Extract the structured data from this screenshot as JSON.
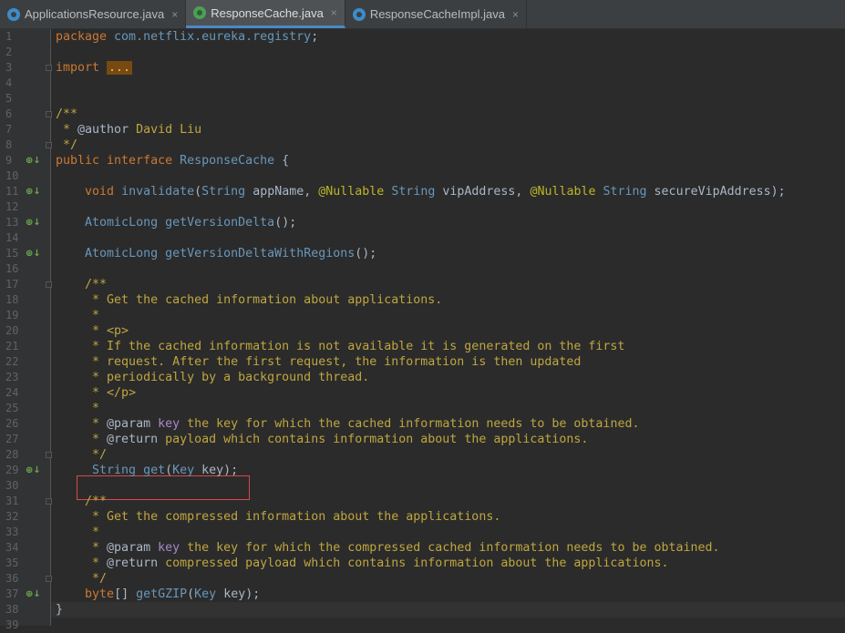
{
  "tabs": [
    {
      "label": "ApplicationsResource.java",
      "icon": "class-icon",
      "active": false
    },
    {
      "label": "ResponseCache.java",
      "icon": "interface-icon",
      "active": true
    },
    {
      "label": "ResponseCacheImpl.java",
      "icon": "class-icon",
      "active": false
    }
  ],
  "close_glyph": "×",
  "gutter_marker": "⊕↓",
  "lines": [
    {
      "n": "1",
      "tokens": [
        [
          "kw",
          "package "
        ],
        [
          "pkg",
          "com.netflix.eureka.registry"
        ],
        [
          "name",
          ";"
        ]
      ]
    },
    {
      "n": "2",
      "tokens": []
    },
    {
      "n": "3",
      "tokens": [
        [
          "kw",
          "import "
        ],
        [
          "fold",
          "..."
        ]
      ]
    },
    {
      "n": "4",
      "tokens": []
    },
    {
      "n": "5",
      "tokens": []
    },
    {
      "n": "6",
      "tokens": [
        [
          "doc",
          "/**"
        ]
      ]
    },
    {
      "n": "7",
      "tokens": [
        [
          "doc",
          " * "
        ],
        [
          "name",
          "@author "
        ],
        [
          "doc",
          "David Liu"
        ]
      ]
    },
    {
      "n": "8",
      "tokens": [
        [
          "doc",
          " */"
        ]
      ]
    },
    {
      "n": "9",
      "tokens": [
        [
          "kw",
          "public interface "
        ],
        [
          "typ",
          "ResponseCache "
        ],
        [
          "name",
          "{"
        ]
      ]
    },
    {
      "n": "10",
      "tokens": []
    },
    {
      "n": "11",
      "tokens": [
        [
          "name",
          "    "
        ],
        [
          "kw",
          "void "
        ],
        [
          "fn",
          "invalidate"
        ],
        [
          "name",
          "("
        ],
        [
          "typ",
          "String "
        ],
        [
          "name",
          "appName, "
        ],
        [
          "ann",
          "@Nullable "
        ],
        [
          "typ",
          "String "
        ],
        [
          "name",
          "vipAddress, "
        ],
        [
          "ann",
          "@Nullable "
        ],
        [
          "typ",
          "String "
        ],
        [
          "name",
          "secureVipAddress);"
        ]
      ]
    },
    {
      "n": "12",
      "tokens": []
    },
    {
      "n": "13",
      "tokens": [
        [
          "name",
          "    "
        ],
        [
          "typ",
          "AtomicLong "
        ],
        [
          "fn",
          "getVersionDelta"
        ],
        [
          "name",
          "();"
        ]
      ]
    },
    {
      "n": "14",
      "tokens": []
    },
    {
      "n": "15",
      "tokens": [
        [
          "name",
          "    "
        ],
        [
          "typ",
          "AtomicLong "
        ],
        [
          "fn",
          "getVersionDeltaWithRegions"
        ],
        [
          "name",
          "();"
        ]
      ]
    },
    {
      "n": "16",
      "tokens": []
    },
    {
      "n": "17",
      "tokens": [
        [
          "doc",
          "    /**"
        ]
      ]
    },
    {
      "n": "18",
      "tokens": [
        [
          "doc",
          "     * Get the cached information about applications."
        ]
      ]
    },
    {
      "n": "19",
      "tokens": [
        [
          "doc",
          "     *"
        ]
      ]
    },
    {
      "n": "20",
      "tokens": [
        [
          "doc",
          "     * "
        ],
        [
          "tag",
          "<p>"
        ]
      ]
    },
    {
      "n": "21",
      "tokens": [
        [
          "doc",
          "     * If the cached information is not available it is generated on the first"
        ]
      ]
    },
    {
      "n": "22",
      "tokens": [
        [
          "doc",
          "     * request. After the first request, the information is then updated"
        ]
      ]
    },
    {
      "n": "23",
      "tokens": [
        [
          "doc",
          "     * periodically by a background thread."
        ]
      ]
    },
    {
      "n": "24",
      "tokens": [
        [
          "doc",
          "     * "
        ],
        [
          "tag",
          "</p>"
        ]
      ]
    },
    {
      "n": "25",
      "tokens": [
        [
          "doc",
          "     *"
        ]
      ]
    },
    {
      "n": "26",
      "tokens": [
        [
          "doc",
          "     * "
        ],
        [
          "name",
          "@param "
        ],
        [
          "dkey",
          "key "
        ],
        [
          "doc",
          "the key for which the cached information needs to be obtained."
        ]
      ]
    },
    {
      "n": "27",
      "tokens": [
        [
          "doc",
          "     * "
        ],
        [
          "name",
          "@return "
        ],
        [
          "doc",
          "payload which contains information about the applications."
        ]
      ]
    },
    {
      "n": "28",
      "tokens": [
        [
          "doc",
          "     */"
        ]
      ]
    },
    {
      "n": "29",
      "tokens": [
        [
          "name",
          "     "
        ],
        [
          "typ",
          "String "
        ],
        [
          "fn",
          "get"
        ],
        [
          "name",
          "("
        ],
        [
          "typ",
          "Key "
        ],
        [
          "name",
          "key);"
        ]
      ]
    },
    {
      "n": "30",
      "tokens": []
    },
    {
      "n": "31",
      "tokens": [
        [
          "doc",
          "    /**"
        ]
      ]
    },
    {
      "n": "32",
      "tokens": [
        [
          "doc",
          "     * Get the compressed information about the applications."
        ]
      ]
    },
    {
      "n": "33",
      "tokens": [
        [
          "doc",
          "     *"
        ]
      ]
    },
    {
      "n": "34",
      "tokens": [
        [
          "doc",
          "     * "
        ],
        [
          "name",
          "@param "
        ],
        [
          "dkey",
          "key "
        ],
        [
          "doc",
          "the key for which the compressed cached information needs to be obtained."
        ]
      ]
    },
    {
      "n": "35",
      "tokens": [
        [
          "doc",
          "     * "
        ],
        [
          "name",
          "@return "
        ],
        [
          "doc",
          "compressed payload which contains information about the applications."
        ]
      ]
    },
    {
      "n": "36",
      "tokens": [
        [
          "doc",
          "     */"
        ]
      ]
    },
    {
      "n": "37",
      "tokens": [
        [
          "name",
          "    "
        ],
        [
          "kw",
          "byte"
        ],
        [
          "name",
          "[] "
        ],
        [
          "fn",
          "getGZIP"
        ],
        [
          "name",
          "("
        ],
        [
          "typ",
          "Key "
        ],
        [
          "name",
          "key);"
        ]
      ]
    },
    {
      "n": "38",
      "tokens": [
        [
          "name",
          "}"
        ]
      ]
    },
    {
      "n": "39",
      "tokens": []
    }
  ],
  "marked_lines": [
    "9",
    "11",
    "13",
    "15",
    "29",
    "37"
  ],
  "fold_lines": [
    "3",
    "6",
    "8",
    "17",
    "28",
    "31",
    "36"
  ]
}
